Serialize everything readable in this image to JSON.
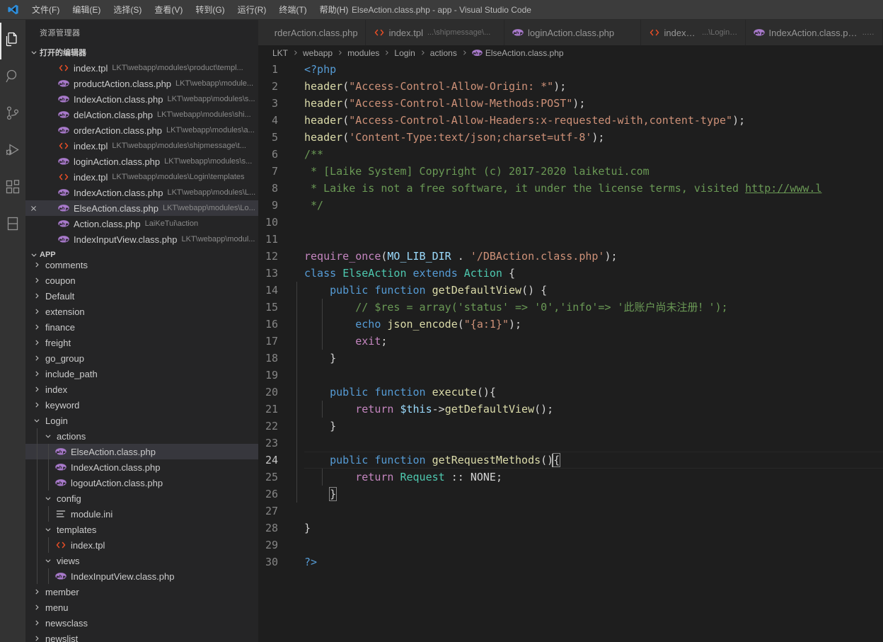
{
  "window": {
    "title": "ElseAction.class.php - app - Visual Studio Code",
    "logo": "vscode-logo"
  },
  "menubar": {
    "items": [
      {
        "label": "文件(F)",
        "name": "menu-file"
      },
      {
        "label": "编辑(E)",
        "name": "menu-edit"
      },
      {
        "label": "选择(S)",
        "name": "menu-selection"
      },
      {
        "label": "查看(V)",
        "name": "menu-view"
      },
      {
        "label": "转到(G)",
        "name": "menu-go"
      },
      {
        "label": "运行(R)",
        "name": "menu-run"
      },
      {
        "label": "终端(T)",
        "name": "menu-terminal"
      },
      {
        "label": "帮助(H)",
        "name": "menu-help"
      }
    ]
  },
  "activitybar": {
    "items": [
      {
        "icon": "files-explorer-icon",
        "name": "activity-explorer",
        "active": true
      },
      {
        "icon": "search-icon",
        "name": "activity-search",
        "active": false
      },
      {
        "icon": "source-control-icon",
        "name": "activity-source-control",
        "active": false
      },
      {
        "icon": "run-debug-icon",
        "name": "activity-run-debug",
        "active": false
      },
      {
        "icon": "extensions-icon",
        "name": "activity-extensions",
        "active": false
      },
      {
        "icon": "remote-explorer-icon",
        "name": "activity-remote-explorer",
        "active": false
      }
    ]
  },
  "sidebar": {
    "title": "资源管理器",
    "open_editors": {
      "header": "打开的编辑器",
      "expanded": true,
      "items": [
        {
          "name": "index.tpl",
          "desc": "LKT\\webapp\\modules\\product\\templ...",
          "icon": "tpl-file-icon",
          "selected": false,
          "has_close": false
        },
        {
          "name": "productAction.class.php",
          "desc": "LKT\\webapp\\module...",
          "icon": "php-file-icon",
          "selected": false,
          "has_close": false
        },
        {
          "name": "IndexAction.class.php",
          "desc": "LKT\\webapp\\modules\\s...",
          "icon": "php-file-icon",
          "selected": false,
          "has_close": false
        },
        {
          "name": "delAction.class.php",
          "desc": "LKT\\webapp\\modules\\shi...",
          "icon": "php-file-icon",
          "selected": false,
          "has_close": false
        },
        {
          "name": "orderAction.class.php",
          "desc": "LKT\\webapp\\modules\\a...",
          "icon": "php-file-icon",
          "selected": false,
          "has_close": false
        },
        {
          "name": "index.tpl",
          "desc": "LKT\\webapp\\modules\\shipmessage\\t...",
          "icon": "tpl-file-icon",
          "selected": false,
          "has_close": false
        },
        {
          "name": "loginAction.class.php",
          "desc": "LKT\\webapp\\modules\\s...",
          "icon": "php-file-icon",
          "selected": false,
          "has_close": false
        },
        {
          "name": "index.tpl",
          "desc": "LKT\\webapp\\modules\\Login\\templates",
          "icon": "tpl-file-icon",
          "selected": false,
          "has_close": false
        },
        {
          "name": "IndexAction.class.php",
          "desc": "LKT\\webapp\\modules\\L...",
          "icon": "php-file-icon",
          "selected": false,
          "has_close": false
        },
        {
          "name": "ElseAction.class.php",
          "desc": "LKT\\webapp\\modules\\Lo...",
          "icon": "php-file-icon",
          "selected": true,
          "has_close": true,
          "close_label": "×"
        },
        {
          "name": "Action.class.php",
          "desc": "LaiKeTui\\action",
          "icon": "php-file-icon",
          "selected": false,
          "has_close": false
        },
        {
          "name": "IndexInputView.class.php",
          "desc": "LKT\\webapp\\modul...",
          "icon": "php-file-icon",
          "selected": false,
          "has_close": false
        }
      ]
    },
    "workspace": {
      "header": "APP",
      "expanded": true,
      "tree": [
        {
          "label": "comments",
          "depth": 1,
          "type": "folder",
          "state": "collapsed"
        },
        {
          "label": "coupon",
          "depth": 1,
          "type": "folder",
          "state": "collapsed"
        },
        {
          "label": "Default",
          "depth": 1,
          "type": "folder",
          "state": "collapsed"
        },
        {
          "label": "extension",
          "depth": 1,
          "type": "folder",
          "state": "collapsed"
        },
        {
          "label": "finance",
          "depth": 1,
          "type": "folder",
          "state": "collapsed"
        },
        {
          "label": "freight",
          "depth": 1,
          "type": "folder",
          "state": "collapsed"
        },
        {
          "label": "go_group",
          "depth": 1,
          "type": "folder",
          "state": "collapsed"
        },
        {
          "label": "include_path",
          "depth": 1,
          "type": "folder",
          "state": "collapsed"
        },
        {
          "label": "index",
          "depth": 1,
          "type": "folder",
          "state": "collapsed"
        },
        {
          "label": "keyword",
          "depth": 1,
          "type": "folder",
          "state": "collapsed"
        },
        {
          "label": "Login",
          "depth": 1,
          "type": "folder",
          "state": "expanded"
        },
        {
          "label": "actions",
          "depth": 2,
          "type": "folder",
          "state": "expanded"
        },
        {
          "label": "ElseAction.class.php",
          "depth": 3,
          "type": "file",
          "icon": "php-file-icon",
          "selected": true
        },
        {
          "label": "IndexAction.class.php",
          "depth": 3,
          "type": "file",
          "icon": "php-file-icon"
        },
        {
          "label": "logoutAction.class.php",
          "depth": 3,
          "type": "file",
          "icon": "php-file-icon"
        },
        {
          "label": "config",
          "depth": 2,
          "type": "folder",
          "state": "expanded"
        },
        {
          "label": "module.ini",
          "depth": 3,
          "type": "file",
          "icon": "ini-file-icon"
        },
        {
          "label": "templates",
          "depth": 2,
          "type": "folder",
          "state": "expanded"
        },
        {
          "label": "index.tpl",
          "depth": 3,
          "type": "file",
          "icon": "tpl-file-icon"
        },
        {
          "label": "views",
          "depth": 2,
          "type": "folder",
          "state": "expanded"
        },
        {
          "label": "IndexInputView.class.php",
          "depth": 3,
          "type": "file",
          "icon": "php-file-icon"
        },
        {
          "label": "member",
          "depth": 1,
          "type": "folder",
          "state": "collapsed"
        },
        {
          "label": "menu",
          "depth": 1,
          "type": "folder",
          "state": "collapsed"
        },
        {
          "label": "newsclass",
          "depth": 1,
          "type": "folder",
          "state": "collapsed"
        },
        {
          "label": "newslist",
          "depth": 1,
          "type": "folder",
          "state": "collapsed"
        }
      ]
    }
  },
  "tabs": [
    {
      "label": "rderAction.class.php",
      "desc": "",
      "icon": "php-file-icon",
      "active": false,
      "clipped": true
    },
    {
      "label": "index.tpl",
      "desc": "...\\shipmessage\\...",
      "icon": "tpl-file-icon",
      "active": false
    },
    {
      "label": "loginAction.class.php",
      "desc": "",
      "icon": "php-file-icon",
      "active": false
    },
    {
      "label": "index.tpl",
      "desc": "...\\Login\\...",
      "icon": "tpl-file-icon",
      "active": false
    },
    {
      "label": "IndexAction.class.php",
      "desc": "...\\L",
      "icon": "php-file-icon",
      "active": false
    }
  ],
  "breadcrumbs": [
    {
      "label": "LKT",
      "icon": null
    },
    {
      "label": "webapp",
      "icon": null
    },
    {
      "label": "modules",
      "icon": null
    },
    {
      "label": "Login",
      "icon": null
    },
    {
      "label": "actions",
      "icon": null
    },
    {
      "label": "ElseAction.class.php",
      "icon": "php-file-icon"
    }
  ],
  "editor": {
    "language": "php",
    "cursor_line": 24,
    "lines": [
      {
        "n": 1,
        "tokens": [
          {
            "t": "<?php",
            "c": "t-tag"
          }
        ]
      },
      {
        "n": 2,
        "tokens": [
          {
            "t": "header",
            "c": "t-fn"
          },
          {
            "t": "(",
            "c": "t-punc"
          },
          {
            "t": "\"Access-Control-Allow-Origin: *\"",
            "c": "t-str"
          },
          {
            "t": ");",
            "c": "t-punc"
          }
        ]
      },
      {
        "n": 3,
        "tokens": [
          {
            "t": "header",
            "c": "t-fn"
          },
          {
            "t": "(",
            "c": "t-punc"
          },
          {
            "t": "\"Access-Control-Allow-Methods:POST\"",
            "c": "t-str"
          },
          {
            "t": ");",
            "c": "t-punc"
          }
        ]
      },
      {
        "n": 4,
        "tokens": [
          {
            "t": "header",
            "c": "t-fn"
          },
          {
            "t": "(",
            "c": "t-punc"
          },
          {
            "t": "\"Access-Control-Allow-Headers:x-requested-with,content-type\"",
            "c": "t-str"
          },
          {
            "t": ");",
            "c": "t-punc"
          }
        ]
      },
      {
        "n": 5,
        "tokens": [
          {
            "t": "header",
            "c": "t-fn"
          },
          {
            "t": "(",
            "c": "t-punc"
          },
          {
            "t": "'Content-Type:text/json;charset=utf-8'",
            "c": "t-str"
          },
          {
            "t": ");",
            "c": "t-punc"
          }
        ]
      },
      {
        "n": 6,
        "tokens": [
          {
            "t": "/**",
            "c": "t-cmt"
          }
        ]
      },
      {
        "n": 7,
        "tokens": [
          {
            "t": " * [Laike System] Copyright (c) 2017-2020 laiketui.com",
            "c": "t-cmt"
          }
        ]
      },
      {
        "n": 8,
        "tokens": [
          {
            "t": " * Laike is not a free software, it under the license terms, visited ",
            "c": "t-cmt"
          },
          {
            "t": "http://www.l",
            "c": "t-link"
          }
        ]
      },
      {
        "n": 9,
        "tokens": [
          {
            "t": " */",
            "c": "t-cmt"
          }
        ]
      },
      {
        "n": 10,
        "tokens": []
      },
      {
        "n": 11,
        "tokens": []
      },
      {
        "n": 12,
        "tokens": [
          {
            "t": "require_once",
            "c": "t-kw2"
          },
          {
            "t": "(",
            "c": "t-punc"
          },
          {
            "t": "MO_LIB_DIR",
            "c": "t-const"
          },
          {
            "t": " . ",
            "c": "t-punc"
          },
          {
            "t": "'/DBAction.class.php'",
            "c": "t-str"
          },
          {
            "t": ");",
            "c": "t-punc"
          }
        ]
      },
      {
        "n": 13,
        "tokens": [
          {
            "t": "class",
            "c": "t-kw"
          },
          {
            "t": " ",
            "c": "t-plain"
          },
          {
            "t": "ElseAction",
            "c": "t-type"
          },
          {
            "t": " ",
            "c": "t-plain"
          },
          {
            "t": "extends",
            "c": "t-kw"
          },
          {
            "t": " ",
            "c": "t-plain"
          },
          {
            "t": "Action",
            "c": "t-type"
          },
          {
            "t": " {",
            "c": "t-punc"
          }
        ]
      },
      {
        "n": 14,
        "indent": 1,
        "tokens": [
          {
            "t": "    ",
            "c": "t-plain"
          },
          {
            "t": "public",
            "c": "t-kw"
          },
          {
            "t": " ",
            "c": "t-plain"
          },
          {
            "t": "function",
            "c": "t-kw"
          },
          {
            "t": " ",
            "c": "t-plain"
          },
          {
            "t": "getDefaultView",
            "c": "t-fn"
          },
          {
            "t": "() {",
            "c": "t-punc"
          }
        ]
      },
      {
        "n": 15,
        "indent": 2,
        "tokens": [
          {
            "t": "        ",
            "c": "t-plain"
          },
          {
            "t": "// $res = array('status' => '0','info'=> '此账户尚未注册！');",
            "c": "t-cmt"
          }
        ]
      },
      {
        "n": 16,
        "indent": 2,
        "tokens": [
          {
            "t": "        ",
            "c": "t-plain"
          },
          {
            "t": "echo",
            "c": "t-kw"
          },
          {
            "t": " ",
            "c": "t-plain"
          },
          {
            "t": "json_encode",
            "c": "t-fn"
          },
          {
            "t": "(",
            "c": "t-punc"
          },
          {
            "t": "\"{a:1}\"",
            "c": "t-str"
          },
          {
            "t": ");",
            "c": "t-punc"
          }
        ]
      },
      {
        "n": 17,
        "indent": 2,
        "tokens": [
          {
            "t": "        ",
            "c": "t-plain"
          },
          {
            "t": "exit",
            "c": "t-kw2"
          },
          {
            "t": ";",
            "c": "t-punc"
          }
        ]
      },
      {
        "n": 18,
        "indent": 1,
        "tokens": [
          {
            "t": "    }",
            "c": "t-punc"
          }
        ]
      },
      {
        "n": 19,
        "indent": 1,
        "tokens": []
      },
      {
        "n": 20,
        "indent": 1,
        "tokens": [
          {
            "t": "    ",
            "c": "t-plain"
          },
          {
            "t": "public",
            "c": "t-kw"
          },
          {
            "t": " ",
            "c": "t-plain"
          },
          {
            "t": "function",
            "c": "t-kw"
          },
          {
            "t": " ",
            "c": "t-plain"
          },
          {
            "t": "execute",
            "c": "t-fn"
          },
          {
            "t": "(){",
            "c": "t-punc"
          }
        ]
      },
      {
        "n": 21,
        "indent": 2,
        "tokens": [
          {
            "t": "        ",
            "c": "t-plain"
          },
          {
            "t": "return",
            "c": "t-kw2"
          },
          {
            "t": " ",
            "c": "t-plain"
          },
          {
            "t": "$this",
            "c": "t-var"
          },
          {
            "t": "->",
            "c": "t-punc"
          },
          {
            "t": "getDefaultView",
            "c": "t-fn"
          },
          {
            "t": "();",
            "c": "t-punc"
          }
        ]
      },
      {
        "n": 22,
        "indent": 1,
        "tokens": [
          {
            "t": "    }",
            "c": "t-punc"
          }
        ]
      },
      {
        "n": 23,
        "indent": 1,
        "tokens": []
      },
      {
        "n": 24,
        "indent": 1,
        "current": true,
        "tokens": [
          {
            "t": "    ",
            "c": "t-plain"
          },
          {
            "t": "public",
            "c": "t-kw"
          },
          {
            "t": " ",
            "c": "t-plain"
          },
          {
            "t": "function",
            "c": "t-kw"
          },
          {
            "t": " ",
            "c": "t-plain"
          },
          {
            "t": "getRequestMethods",
            "c": "t-fn"
          },
          {
            "t": "()",
            "c": "t-punc"
          },
          {
            "t": "{",
            "c": "t-punc bracket-hl"
          }
        ]
      },
      {
        "n": 25,
        "indent": 2,
        "tokens": [
          {
            "t": "        ",
            "c": "t-plain"
          },
          {
            "t": "return",
            "c": "t-kw2"
          },
          {
            "t": " ",
            "c": "t-plain"
          },
          {
            "t": "Request",
            "c": "t-type"
          },
          {
            "t": " :: ",
            "c": "t-punc"
          },
          {
            "t": "NONE",
            "c": "t-plain"
          },
          {
            "t": ";",
            "c": "t-punc"
          }
        ]
      },
      {
        "n": 26,
        "indent": 1,
        "tokens": [
          {
            "t": "    ",
            "c": "t-plain"
          },
          {
            "t": "}",
            "c": "t-punc bracket-hl"
          }
        ]
      },
      {
        "n": 27,
        "tokens": []
      },
      {
        "n": 28,
        "tokens": [
          {
            "t": "}",
            "c": "t-punc"
          }
        ]
      },
      {
        "n": 29,
        "tokens": []
      },
      {
        "n": 30,
        "tokens": [
          {
            "t": "?>",
            "c": "t-tag"
          }
        ]
      }
    ]
  },
  "colors": {
    "titlebar_bg": "#3c3c3c",
    "activitybar_bg": "#333333",
    "sidebar_bg": "#252526",
    "editor_bg": "#1e1e1e",
    "tab_inactive_bg": "#2d2d2d",
    "accent_selected": "#37373d",
    "php_icon": "#8993be",
    "tpl_icon": "#e44d26"
  }
}
